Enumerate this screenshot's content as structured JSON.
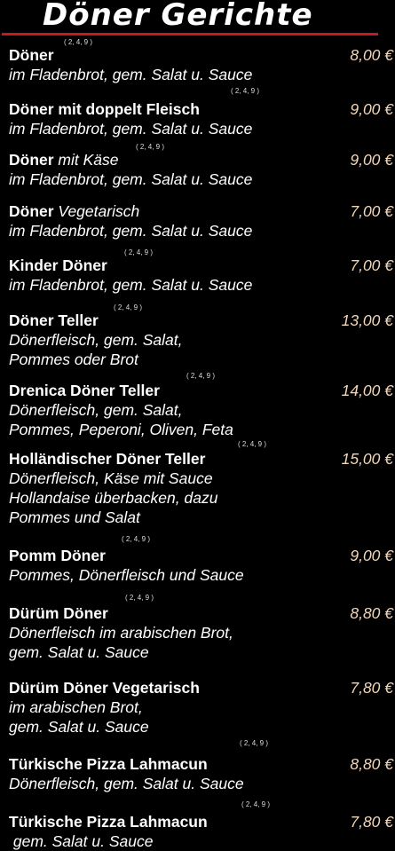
{
  "header": {
    "title": "Döner Gerichte"
  },
  "items": [
    {
      "name": "Döner",
      "desc": "",
      "sup": "( 2, 4, 9 )",
      "price": "8,00 €",
      "lines": [
        "im Fladenbrot, gem. Salat u. Sauce"
      ]
    },
    {
      "name": "Döner mit doppelt Fleisch",
      "desc": "",
      "sup": "( 2, 4, 9 )",
      "price": "9,00 €",
      "lines": [
        "im Fladenbrot, gem. Salat u. Sauce"
      ]
    },
    {
      "name": "Döner",
      "desc": " mit Käse",
      "sup": "( 2, 4, 9 )",
      "price": "9,00 €",
      "lines": [
        "im Fladenbrot, gem. Salat u. Sauce"
      ]
    },
    {
      "name": "Döner",
      "desc": " Vegetarisch",
      "sup": "",
      "price": "7,00 €",
      "lines": [
        "im Fladenbrot, gem. Salat u. Sauce"
      ]
    },
    {
      "name": "Kinder Döner",
      "desc": "",
      "sup": "( 2, 4, 9 )",
      "price": "7,00 €",
      "lines": [
        "im Fladenbrot, gem. Salat u. Sauce"
      ]
    },
    {
      "name": "Döner Teller",
      "desc": "",
      "sup": "( 2, 4, 9 )",
      "price": "13,00 €",
      "lines": [
        "Dönerfleisch, gem. Salat,",
        "Pommes oder Brot"
      ]
    },
    {
      "name": "Drenica Döner Teller",
      "desc": "",
      "sup": "( 2, 4, 9 )",
      "price": "14,00 €",
      "lines": [
        "Dönerfleisch, gem. Salat,",
        "Pommes, Peperoni, Oliven, Feta"
      ]
    },
    {
      "name": "Holländischer Döner Teller",
      "desc": "",
      "sup": "( 2, 4, 9 )",
      "price": "15,00 €",
      "lines": [
        "Dönerfleisch, Käse mit Sauce",
        "Hollandaise überbacken, dazu",
        "Pommes und Salat"
      ]
    },
    {
      "name": "Pomm Döner",
      "desc": "",
      "sup": "( 2, 4, 9 )",
      "price": "9,00 €",
      "lines": [
        "Pommes, Dönerfleisch und Sauce"
      ]
    },
    {
      "name": "Dürüm Döner",
      "desc": "",
      "sup": "( 2, 4, 9 )",
      "price": "8,80 €",
      "lines": [
        "Dönerfleisch im arabischen Brot,",
        "gem. Salat u. Sauce"
      ]
    },
    {
      "name": "Dürüm Döner Vegetarisch",
      "desc": "",
      "sup": "",
      "price": "7,80 €",
      "lines": [
        "im arabischen Brot,",
        "gem. Salat u. Sauce"
      ]
    },
    {
      "name": "Türkische Pizza Lahmacun",
      "desc": "",
      "sup": "( 2, 4, 9 )",
      "price": "8,80 €",
      "lines": [
        "Dönerfleisch, gem. Salat u. Sauce"
      ]
    },
    {
      "name": "Türkische Pizza Lahmacun",
      "desc": "",
      "sup": "( 2, 4, 9 )",
      "price": "7,80 €",
      "lines": [
        " gem. Salat u. Sauce"
      ]
    }
  ]
}
